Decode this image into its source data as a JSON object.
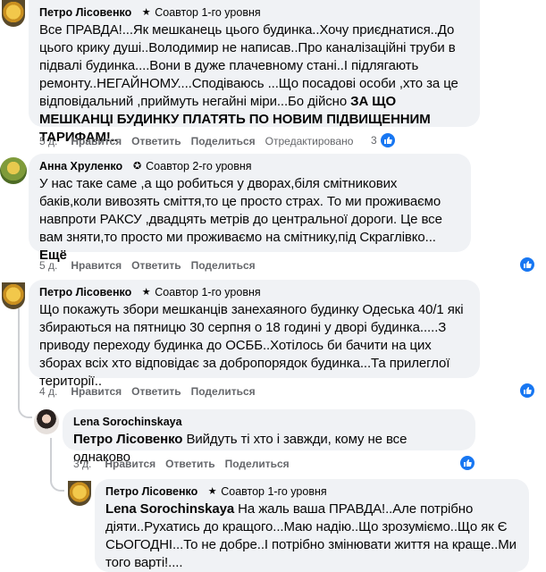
{
  "comments": [
    {
      "author": "Петро Лісовенко",
      "badge": "Соавтор 1-го уровня",
      "badge_icon": "star-icon",
      "text_part1": "Все ПРАВДА!...Як мешканець цього будинка..Хочу приєднатися..До цього крику душі..Володимир не написав..Про каналізаційні труби в підвалі будинка....Вони в дуже плачевному стані..І підлягають ремонту..НЕГАЙНОМУ....Сподіваюсь ...Що посадові особи ,хто за це відповідальний ,приймуть негайні міри...Бо дійсно ",
      "text_bold": "ЗА ЩО МЕШКАНЦІ БУДИНКУ ПЛАТЯТЬ ПО НОВИМ ПІДВИЩЕННИМ ТАРИФАМ!..",
      "time": "5 д.",
      "like": "Нравится",
      "reply": "Ответить",
      "share": "Поделиться",
      "status": "Отредактировано",
      "likes": "3"
    },
    {
      "author": "Анна Хруленко",
      "badge": "Соавтор 2-го уровня",
      "badge_icon": "ribbon-icon",
      "text": "У нас таке саме ,а що робиться у дворах,біля смітникових баків,коли вивозять сміття,то це просто страх. То ми проживаємо навпроти РАКСУ ,двадцять метрів до центральної дороги. Це все вам зняти,то просто ми проживаємо на смітнику,під Скраглівко...",
      "more": "Ещё",
      "time": "5 д.",
      "like": "Нравится",
      "reply": "Ответить",
      "share": "Поделиться"
    },
    {
      "author": "Петро Лісовенко",
      "badge": "Соавтор 1-го уровня",
      "badge_icon": "star-icon",
      "text": "Що покажуть збори мешканців занехаяного будинку Одеська 40/1 які збираються на пятницю 30 серпня о 18 годині у дворі будинка.....З приводу переходу будинка до ОСББ..Хотілось би бачити на цих зборах всіх хто відповідає за добропорядок будинка...Та прилеглої території..",
      "time": "4 д.",
      "like": "Нравится",
      "reply": "Ответить",
      "share": "Поделиться"
    },
    {
      "author": "Lena Sorochinskaya",
      "mention": "Петро Лісовенко",
      "text": "Вийдуть ті хто і завжди, кому не все однаково",
      "time": "3 д.",
      "like": "Нравится",
      "reply": "Ответить",
      "share": "Поделиться"
    },
    {
      "author": "Петро Лісовенко",
      "badge": "Соавтор 1-го уровня",
      "badge_icon": "star-icon",
      "mention": "Lena Sorochinskaya",
      "text": "На жаль ваша ПРАВДА!..Але потрібно діяти..Рухатись до кращого...Маю надію..Що зрозуміємо..Що як Є СЬОГОДНІ...То не добре..І потрібно змінювати життя на краще..Ми того варті!...."
    }
  ],
  "colors": {
    "bubble": "#f0f2f5",
    "meta": "#65676b",
    "like_blue": "#1877f2"
  }
}
